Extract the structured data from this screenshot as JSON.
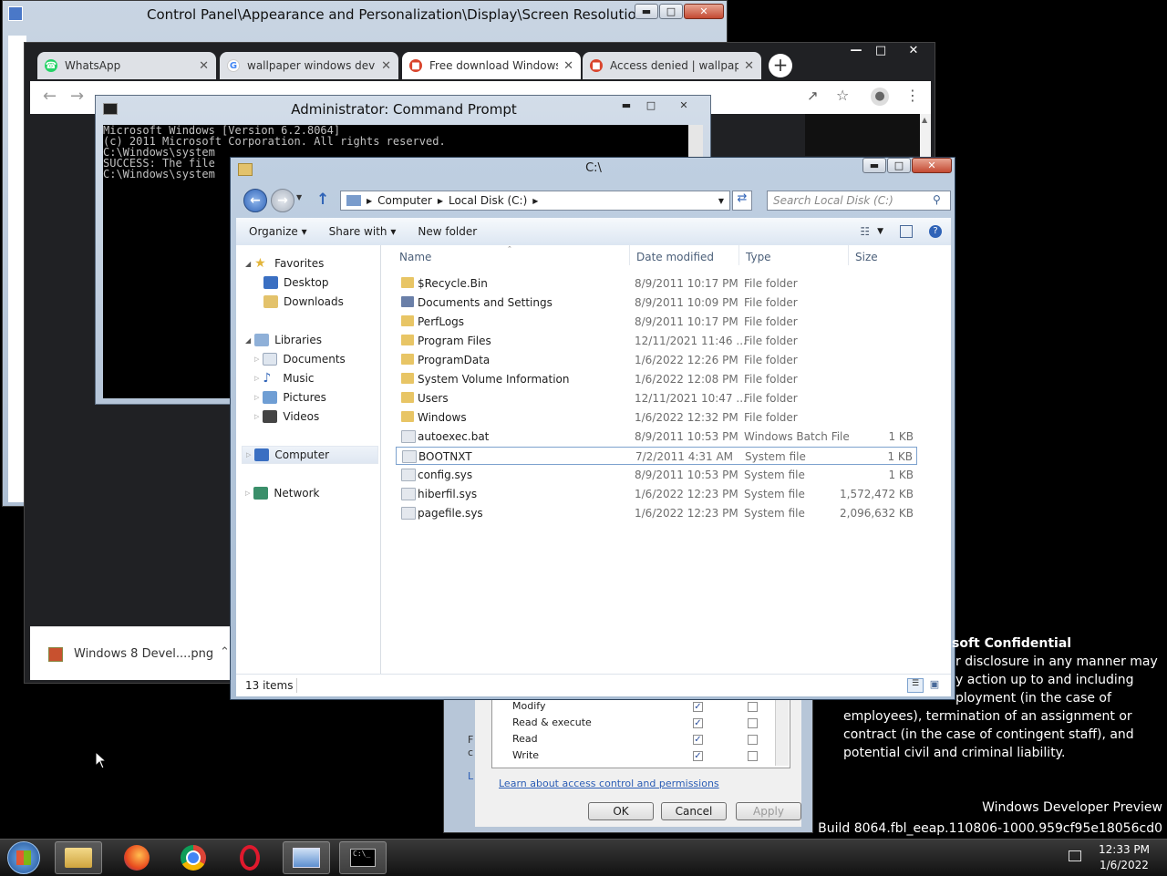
{
  "control_panel": {
    "title": "Control Panel\\Appearance and Personalization\\Display\\Screen Resolution"
  },
  "browser": {
    "tabs": [
      {
        "label": "WhatsApp",
        "icon": "whatsapp-icon",
        "color": "#25d366"
      },
      {
        "label": "wallpaper windows devel",
        "icon": "google-icon",
        "color": "#4285f4"
      },
      {
        "label": "Free download Windows",
        "icon": "site-icon",
        "color": "#d9442c"
      },
      {
        "label": "Access denied | wallpape",
        "icon": "site-icon",
        "color": "#d9442c"
      }
    ],
    "new_tab": "+",
    "download_item": "Windows 8 Devel....png"
  },
  "cmd": {
    "title": "Administrator: Command Prompt",
    "lines": [
      "Microsoft Windows [Version 6.2.8064]",
      "(c) 2011 Microsoft Corporation. All rights reserved.",
      "",
      "C:\\Windows\\system",
      "",
      "SUCCESS: The file",
      "",
      "C:\\Windows\\system"
    ]
  },
  "explorer": {
    "title": "C:\\",
    "breadcrumb": [
      "Computer",
      "Local Disk (C:)"
    ],
    "search_placeholder": "Search Local Disk (C:)",
    "commands": [
      "Organize ▾",
      "Share with ▾",
      "New folder"
    ],
    "nav": {
      "favorites": "Favorites",
      "desktop": "Desktop",
      "downloads": "Downloads",
      "libraries": "Libraries",
      "documents": "Documents",
      "music": "Music",
      "pictures": "Pictures",
      "videos": "Videos",
      "computer": "Computer",
      "network": "Network"
    },
    "columns": {
      "name": "Name",
      "date": "Date modified",
      "type": "Type",
      "size": "Size"
    },
    "files": [
      {
        "name": "$Recycle.Bin",
        "date": "8/9/2011 10:17 PM",
        "type": "File folder",
        "size": "",
        "kind": "folder"
      },
      {
        "name": "Documents and Settings",
        "date": "8/9/2011 10:09 PM",
        "type": "File folder",
        "size": "",
        "kind": "link"
      },
      {
        "name": "PerfLogs",
        "date": "8/9/2011 10:17 PM",
        "type": "File folder",
        "size": "",
        "kind": "folder"
      },
      {
        "name": "Program Files",
        "date": "12/11/2021 11:46 ...",
        "type": "File folder",
        "size": "",
        "kind": "folder"
      },
      {
        "name": "ProgramData",
        "date": "1/6/2022 12:26 PM",
        "type": "File folder",
        "size": "",
        "kind": "folder"
      },
      {
        "name": "System Volume Information",
        "date": "1/6/2022 12:08 PM",
        "type": "File folder",
        "size": "",
        "kind": "folder"
      },
      {
        "name": "Users",
        "date": "12/11/2021 10:47 ...",
        "type": "File folder",
        "size": "",
        "kind": "folder"
      },
      {
        "name": "Windows",
        "date": "1/6/2022 12:32 PM",
        "type": "File folder",
        "size": "",
        "kind": "folder"
      },
      {
        "name": "autoexec.bat",
        "date": "8/9/2011 10:53 PM",
        "type": "Windows Batch File",
        "size": "1 KB",
        "kind": "file"
      },
      {
        "name": "BOOTNXT",
        "date": "7/2/2011 4:31 AM",
        "type": "System file",
        "size": "1 KB",
        "kind": "file"
      },
      {
        "name": "config.sys",
        "date": "8/9/2011 10:53 PM",
        "type": "System file",
        "size": "1 KB",
        "kind": "file"
      },
      {
        "name": "hiberfil.sys",
        "date": "1/6/2022 12:23 PM",
        "type": "System file",
        "size": "1,572,472 KB",
        "kind": "file"
      },
      {
        "name": "pagefile.sys",
        "date": "1/6/2022 12:23 PM",
        "type": "System file",
        "size": "2,096,632 KB",
        "kind": "file"
      }
    ],
    "status": "13 items"
  },
  "permissions": {
    "rows": [
      "Modify",
      "Read & execute",
      "Read",
      "Write"
    ],
    "link": "Learn about access control and permissions",
    "ok": "OK",
    "cancel": "Cancel",
    "apply": "Apply"
  },
  "desktop": {
    "confidential_title": "soft Confidential",
    "confidential_lines": [
      "r disclosure in any manner may",
      "y action up to and including",
      "ployment (in the case of",
      "employees), termination of an assignment or",
      "contract (in the case of contingent staff), and",
      "potential civil and criminal liability."
    ],
    "build_line1": "Windows Developer Preview",
    "build_line2": "Build 8064.fbl_eeap.110806-1000.959cf95e18056cd0"
  },
  "taskbar": {
    "time": "12:33 PM",
    "date": "1/6/2022"
  }
}
